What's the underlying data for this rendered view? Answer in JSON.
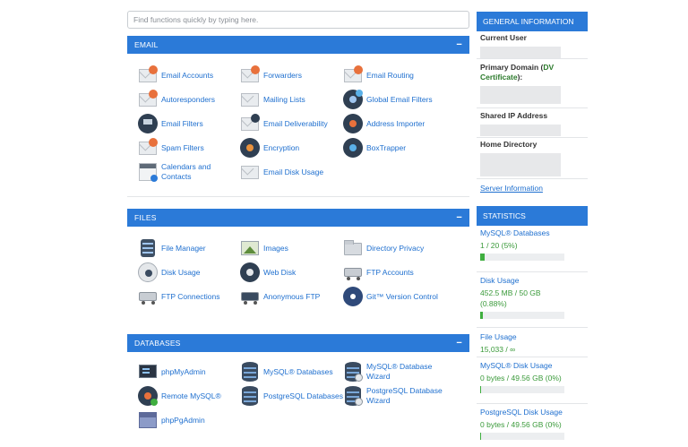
{
  "search": {
    "placeholder": "Find functions quickly by typing here."
  },
  "panels": {
    "email": {
      "title": "EMAIL",
      "collapse": "−",
      "items": [
        {
          "label": "Email Accounts",
          "icon": "email-accounts-icon"
        },
        {
          "label": "Forwarders",
          "icon": "forwarders-icon"
        },
        {
          "label": "Email Routing",
          "icon": "email-routing-icon"
        },
        {
          "label": "Autoresponders",
          "icon": "autoresponders-icon"
        },
        {
          "label": "Mailing Lists",
          "icon": "mailing-lists-icon"
        },
        {
          "label": "Global Email Filters",
          "icon": "global-email-filters-icon"
        },
        {
          "label": "Email Filters",
          "icon": "email-filters-icon"
        },
        {
          "label": "Email Deliverability",
          "icon": "email-deliverability-icon"
        },
        {
          "label": "Address Importer",
          "icon": "address-importer-icon"
        },
        {
          "label": "Spam Filters",
          "icon": "spam-filters-icon"
        },
        {
          "label": "Encryption",
          "icon": "encryption-key-icon"
        },
        {
          "label": "BoxTrapper",
          "icon": "boxtrapper-icon"
        },
        {
          "label": "Calendars and Contacts",
          "icon": "calendar-icon"
        },
        {
          "label": "Email Disk Usage",
          "icon": "email-disk-usage-icon"
        }
      ]
    },
    "files": {
      "title": "FILES",
      "collapse": "−",
      "items": [
        {
          "label": "File Manager",
          "icon": "file-manager-icon"
        },
        {
          "label": "Images",
          "icon": "images-icon"
        },
        {
          "label": "Directory Privacy",
          "icon": "directory-privacy-icon"
        },
        {
          "label": "Disk Usage",
          "icon": "disk-usage-icon"
        },
        {
          "label": "Web Disk",
          "icon": "web-disk-icon"
        },
        {
          "label": "FTP Accounts",
          "icon": "ftp-accounts-icon"
        },
        {
          "label": "FTP Connections",
          "icon": "ftp-connections-icon"
        },
        {
          "label": "Anonymous FTP",
          "icon": "anonymous-ftp-icon"
        },
        {
          "label": "Git™ Version Control",
          "icon": "git-icon"
        }
      ]
    },
    "databases": {
      "title": "DATABASES",
      "collapse": "−",
      "items": [
        {
          "label": "phpMyAdmin",
          "icon": "phpmyadmin-icon"
        },
        {
          "label": "MySQL® Databases",
          "icon": "mysql-databases-icon"
        },
        {
          "label": "MySQL® Database Wizard",
          "icon": "mysql-wizard-icon"
        },
        {
          "label": "Remote MySQL®",
          "icon": "remote-mysql-icon"
        },
        {
          "label": "PostgreSQL Databases",
          "icon": "postgresql-databases-icon"
        },
        {
          "label": "PostgreSQL Database Wizard",
          "icon": "postgresql-wizard-icon"
        },
        {
          "label": "phpPgAdmin",
          "icon": "phppgadmin-icon"
        }
      ]
    }
  },
  "general": {
    "title": "GENERAL INFORMATION",
    "current_user": "Current User",
    "primary_domain": "Primary Domain (",
    "dv_link": "DV Certificate",
    "primary_domain_close": "):",
    "shared_ip": "Shared IP Address",
    "home_directory": "Home Directory",
    "server_info": "Server Information"
  },
  "statistics": {
    "title": "STATISTICS",
    "items": [
      {
        "label": "MySQL® Databases",
        "value": "1 / 20   (5%)",
        "fraction": 0.05,
        "has_bar": true
      },
      {
        "label": "Disk Usage",
        "value": "452.5 MB / 50 GB",
        "value2": "(0.88%)",
        "fraction": 0.0088,
        "has_bar": true
      },
      {
        "label": "File Usage",
        "value": "15,033 / ∞",
        "has_bar": false
      },
      {
        "label": "MySQL® Disk Usage",
        "value": "0 bytes / 49.56 GB   (0%)",
        "fraction": 0,
        "has_bar": true
      },
      {
        "label": "PostgreSQL Disk Usage",
        "value": "0 bytes / 49.56 GB   (0%)",
        "fraction": 0,
        "has_bar": true
      }
    ]
  },
  "colors": {
    "accent": "#2b7ad8",
    "link": "#1e6fcf",
    "ok": "#3fae3f"
  }
}
